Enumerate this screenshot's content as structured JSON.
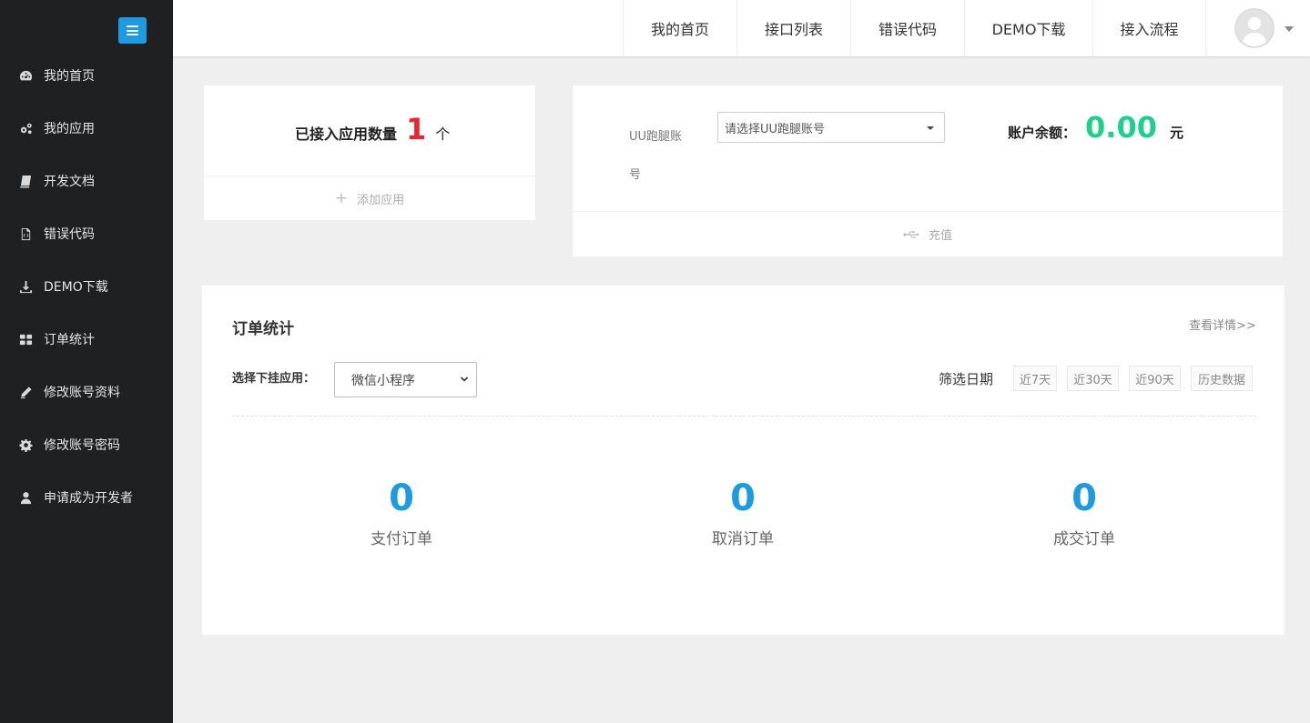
{
  "sidebar": {
    "items": [
      {
        "label": "我的首页",
        "icon": "dashboard-icon"
      },
      {
        "label": "我的应用",
        "icon": "cogs-icon"
      },
      {
        "label": "开发文档",
        "icon": "book-icon"
      },
      {
        "label": "错误代码",
        "icon": "file-code-icon"
      },
      {
        "label": "DEMO下载",
        "icon": "download-icon"
      },
      {
        "label": "订单统计",
        "icon": "grid-icon"
      },
      {
        "label": "修改账号资料",
        "icon": "pencil-icon"
      },
      {
        "label": "修改账号密码",
        "icon": "gear-icon"
      },
      {
        "label": "申请成为开发者",
        "icon": "user-icon"
      }
    ]
  },
  "topnav": {
    "items": [
      "我的首页",
      "接口列表",
      "错误代码",
      "DEMO下载",
      "接入流程"
    ]
  },
  "app_card": {
    "label": "已接入应用数量",
    "count": "1",
    "unit": "个",
    "add_label": "添加应用"
  },
  "account_card": {
    "account_label": "UU跑腿账号",
    "account_placeholder": "请选择UU跑腿账号",
    "balance_label": "账户余额：",
    "balance_value": "0.00",
    "balance_unit": "元",
    "recharge_label": "充值"
  },
  "orders": {
    "title": "订单统计",
    "detail_link": "查看详情>>",
    "app_select_label": "选择下挂应用：",
    "app_select_value": "微信小程序",
    "date_filter_label": "筛选日期",
    "date_buttons": [
      "近7天",
      "近30天",
      "近90天",
      "历史数据"
    ],
    "stats": [
      {
        "value": "0",
        "label": "支付订单"
      },
      {
        "value": "0",
        "label": "取消订单"
      },
      {
        "value": "0",
        "label": "成交订单"
      }
    ]
  },
  "colors": {
    "sidebar_bg": "#1f2021",
    "accent_blue": "#1e9be0",
    "count_red": "#e8262d",
    "balance_green": "#1fcf8e"
  }
}
